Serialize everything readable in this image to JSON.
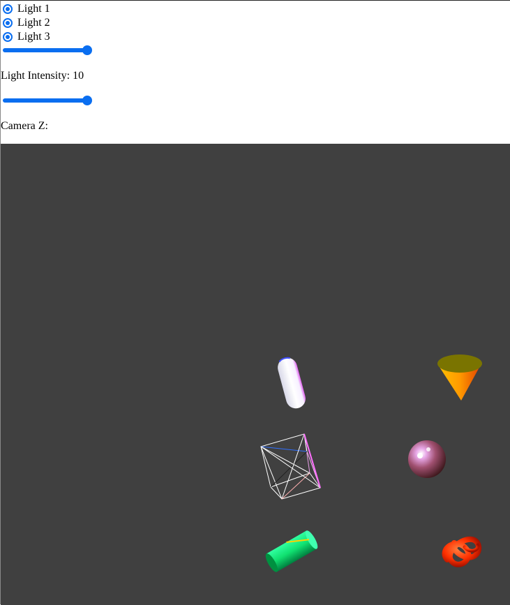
{
  "controls": {
    "lights": [
      {
        "label": "Light 1",
        "checked": true
      },
      {
        "label": "Light 2",
        "checked": true
      },
      {
        "label": "Light 3",
        "checked": true
      }
    ],
    "intensity_slider": {
      "fraction": 1.0
    },
    "intensity_label": "Light Intensity: 10",
    "camera_slider": {
      "fraction": 1.0
    },
    "camera_label": "Camera Z:"
  },
  "viewport": {
    "background": "#404040",
    "objects": [
      "capsule",
      "cone",
      "wireframe-cube",
      "sphere",
      "cylinder",
      "torus-knot"
    ]
  },
  "colors": {
    "accent": "#0a6ef0"
  }
}
